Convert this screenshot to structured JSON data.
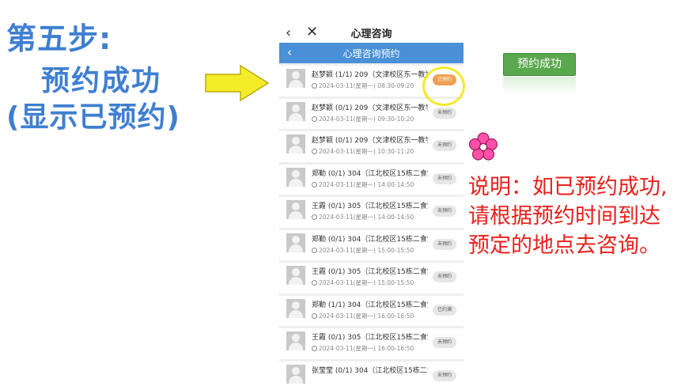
{
  "slide": {
    "title_line1": "第五步:",
    "title_line2": "预约成功",
    "title_line3": "(显示已预约)"
  },
  "phone": {
    "topbar": {
      "back_icon": "‹",
      "close_icon": "✕",
      "title": "心理咨询"
    },
    "navbar": {
      "back_icon": "‹",
      "title": "心理咨询预约"
    },
    "items": [
      {
        "name": "赵梦颖 (1/1) 209（文津校区东一教学…",
        "time": "2024-03-11(星期一) 08:30-09:20",
        "badge": "已预约"
      },
      {
        "name": "赵梦颖 (0/1) 209（文津校区东一教学…",
        "time": "2024-03-11(星期一) 09:30-10:20",
        "badge": "未预约"
      },
      {
        "name": "赵梦颖 (0/1) 209（文津校区东一教学…",
        "time": "2024-03-11(星期一) 10:30-11:20",
        "badge": "未预约"
      },
      {
        "name": "郑勤 (0/1) 304（江北校区15栋二食堂…",
        "time": "2024-03-11(星期一) 14:00-14:50",
        "badge": "未预约"
      },
      {
        "name": "王霞 (0/1) 305（江北校区15栋二食堂…",
        "time": "2024-03-11(星期一) 14:00-14:50",
        "badge": "未预约"
      },
      {
        "name": "郑勤 (0/1) 304（江北校区15栋二食堂…",
        "time": "2024-03-11(星期一) 15:00-15:50",
        "badge": "未预约"
      },
      {
        "name": "王霞 (0/1) 305（江北校区15栋二食堂…",
        "time": "2024-03-11(星期一) 15:00-15:50",
        "badge": "未预约"
      },
      {
        "name": "郑勤 (1/1) 304（江北校区15栋二食堂…",
        "time": "2024-03-11(星期一) 16:00-16:50",
        "badge": "已约满"
      },
      {
        "name": "王霞 (0/1) 305（江北校区15栋二食堂…",
        "time": "2024-03-11(星期一) 16:00-16:50",
        "badge": "未预约"
      },
      {
        "name": "张莹莹 (0/1) 304（江北校区15栋二食…",
        "time": "",
        "badge": "未预约"
      }
    ]
  },
  "success_button_label": "预约成功",
  "description": {
    "line1": "说明：如已预约成功,",
    "line2": "请根据预约时间到达",
    "line3": "预定的地点去咨询。"
  },
  "colors": {
    "heading": "#3f7fd1",
    "navbar": "#4a90d6",
    "booked_badge": "#f0a052",
    "success_button": "#5aa84e",
    "description_text": "#e8201b",
    "arrow_fill": "#f4ec28",
    "flower": "#ff4fa8"
  },
  "icons": [
    "back-icon",
    "close-icon",
    "clock-icon",
    "avatar-placeholder-icon",
    "right-arrow-icon",
    "flower-icon"
  ]
}
